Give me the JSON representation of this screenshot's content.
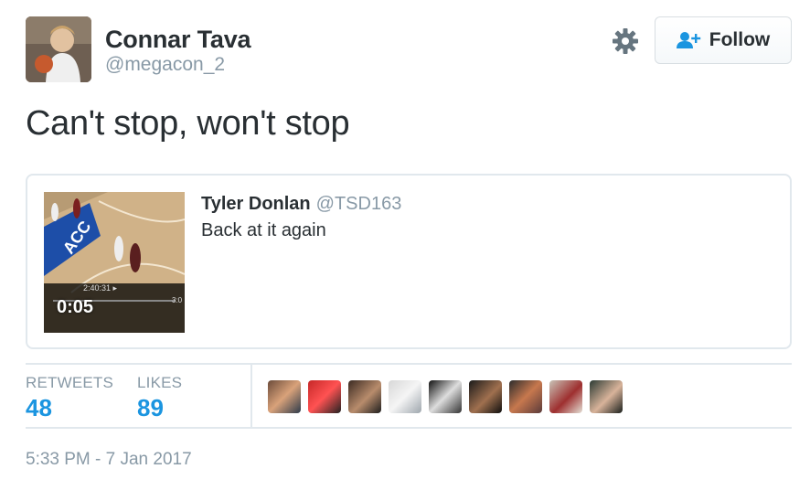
{
  "user": {
    "name": "Connar Tava",
    "handle": "@megacon_2"
  },
  "header": {
    "follow_label": "Follow"
  },
  "tweet": {
    "text": "Can't stop, won't stop",
    "timestamp": "5:33 PM - 7 Jan 2017"
  },
  "quoted": {
    "name": "Tyler Donlan",
    "handle": "@TSD163",
    "text": "Back at it again",
    "video_duration": "0:05",
    "video_overlay_time": "2:40:31 ▸",
    "video_overlay_time_2": "3:0"
  },
  "stats": {
    "retweets_label": "RETWEETS",
    "retweets_value": "48",
    "likes_label": "LIKES",
    "likes_value": "89"
  },
  "colors": {
    "accent": "#1b95e0",
    "secondary_text": "#8899a6",
    "primary_text": "#292f33",
    "border": "#e1e8ed"
  },
  "likers": [
    {
      "name": "liker-avatar-1",
      "bg": "linear-gradient(135deg,#6b4b3a,#d9a27a 50%,#2d3a4a)"
    },
    {
      "name": "liker-avatar-2",
      "bg": "linear-gradient(135deg,#c62828,#ff5252 50%,#222)"
    },
    {
      "name": "liker-avatar-3",
      "bg": "linear-gradient(135deg,#3b2a22,#b88c6c 55%,#1d1d1d)"
    },
    {
      "name": "liker-avatar-4",
      "bg": "linear-gradient(135deg,#d7d7d7,#f5f5f5 50%,#9ea6ad)"
    },
    {
      "name": "liker-avatar-5",
      "bg": "linear-gradient(135deg,#111,#ddd 50%,#333)"
    },
    {
      "name": "liker-avatar-6",
      "bg": "linear-gradient(135deg,#1a1a1a,#a0704f 55%,#0e0e0e)"
    },
    {
      "name": "liker-avatar-7",
      "bg": "linear-gradient(135deg,#2c2c2c,#c7784e 50%,#5a3a3a)"
    },
    {
      "name": "liker-avatar-8",
      "bg": "linear-gradient(135deg,#c9c3b7,#9e2f2f 55%,#e4e0d6)"
    },
    {
      "name": "liker-avatar-9",
      "bg": "linear-gradient(135deg,#2b3a33,#d8b39a 55%,#1a1f1c)"
    }
  ]
}
